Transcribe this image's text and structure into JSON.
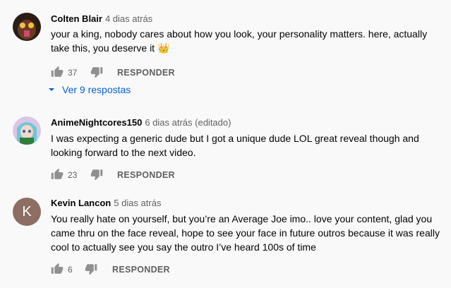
{
  "comments": [
    {
      "author": "Colten Blair",
      "time": "4 dias atrás",
      "text": "your a king, nobody cares about how you look, your personality matters. here, actually take this, you deserve it 👑",
      "likes": "37",
      "reply_label": "RESPONDER",
      "view_replies": "Ver 9 respostas"
    },
    {
      "author": "AnimeNightcores150",
      "time": "6 dias atrás (editado)",
      "text": "I was expecting a generic dude but I got a unique dude LOL great reveal though and looking forward to the next video.",
      "likes": "23",
      "reply_label": "RESPONDER"
    },
    {
      "author": "Kevin Lancon",
      "time": "5 dias atrás",
      "avatar_letter": "K",
      "text": "You really hate on yourself, but you’re an Average Joe imo.. love your content, glad you came thru on the face reveal, hope to see your face in future outros because it was really cool to actually see you say the outro I’ve heard 100s of time",
      "likes": "6",
      "reply_label": "RESPONDER"
    }
  ],
  "colors": {
    "background": "#f9f9f9",
    "link": "#065fd4",
    "secondary_text": "#606060",
    "kevin_avatar": "#8d6e63"
  },
  "icons": [
    "thumb-up-icon",
    "thumb-down-icon",
    "caret-down-icon"
  ]
}
